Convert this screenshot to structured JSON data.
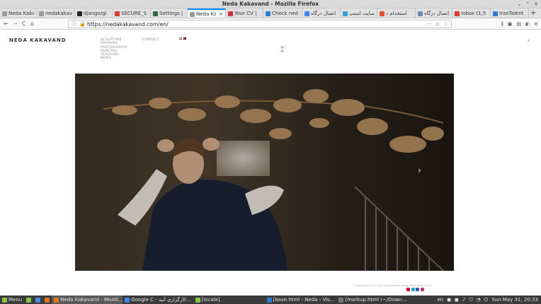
{
  "window": {
    "title": "Neda Kakavand - Mozilla Firefox",
    "controls": [
      "⌄",
      "⌃",
      "✕"
    ]
  },
  "tabs": [
    {
      "label": "Neda Kakava",
      "favicon_color": "#9a9a9a"
    },
    {
      "label": "nedakakavan",
      "favicon_color": "#9a9a9a"
    },
    {
      "label": "django/gi",
      "favicon_color": "#222222"
    },
    {
      "label": "SECURE_S",
      "favicon_color": "#d83b2c"
    },
    {
      "label": "Settings |",
      "favicon_color": "#2f6c3f"
    },
    {
      "label": "Neda Kaka",
      "favicon_color": "#9a9a9a",
      "active": true
    },
    {
      "label": "Your CV |",
      "favicon_color": "#cc3344"
    },
    {
      "label": "Check ned",
      "favicon_color": "#2d7cd6"
    },
    {
      "label": "اتصال درگاه",
      "favicon_color": "#4285f4"
    },
    {
      "label": "سایت اسنپ",
      "favicon_color": "#3aa0d6"
    },
    {
      "label": "استخدام د",
      "favicon_color": "#e0522a"
    },
    {
      "label": "اتصال درگاه",
      "favicon_color": "#6b8db8"
    },
    {
      "label": "Inbox (1,5",
      "favicon_color": "#d83b2c"
    },
    {
      "label": "IranTalent",
      "favicon_color": "#2d7cd6"
    }
  ],
  "new_tab_label": "+",
  "nav": {
    "back": "←",
    "forward": "→",
    "reload": "C",
    "home": "⌂",
    "url": "https://nedakakavand.com/en/",
    "info_icon": "ⓘ",
    "lock_icon": "🔒",
    "url_actions": [
      "···",
      "◇",
      "☆"
    ],
    "toolbar_icons": [
      "⫼",
      "▣",
      "▤",
      "◐",
      "≡"
    ]
  },
  "page": {
    "brand": "NEDA KAKAVAND",
    "menu": [
      "SCULPTURE",
      "DRAWING",
      "PHOTOGRAPHY",
      "PAINTING",
      "TEACHING",
      "NEWS"
    ],
    "contact": "CONTACT",
    "next_arrow": "›",
    "copyright": "© Neda Kakavand. All rights reserved 2023. Persian Studio Design Group",
    "search_icon": "⌕",
    "colors": {
      "flag_iran": [
        "#239f40",
        "#ffffff",
        "#da0000"
      ],
      "flag_uk": "#c8102e",
      "social": [
        "#e60023",
        "#1da1f2",
        "#3b5998",
        "#c13584"
      ]
    }
  },
  "taskbar": {
    "items": [
      {
        "label": "Menu",
        "icon_color": "#8fc34a"
      },
      {
        "label": "",
        "icon_color": "#8fc34a"
      },
      {
        "label": "",
        "icon_color": "#4a90d9"
      },
      {
        "label": "",
        "icon_color": "#e0781a"
      },
      {
        "label": "Neda Kakavand - Mozill...",
        "icon_color": "#e0781a",
        "active": true
      },
      {
        "label": "Google C - کارگزاری آنیه...",
        "icon_color": "#4285f4"
      },
      {
        "label": "[locale]",
        "icon_color": "#8fc34a"
      },
      {
        "label": "[base.html - Neda - Vis...",
        "icon_color": "#2d7cd6"
      },
      {
        "label": "[markup.html (~/Down...",
        "icon_color": "#777777"
      }
    ],
    "tray": {
      "lang": "en",
      "icons": [
        "◼",
        "◼",
        "♪",
        "⛉",
        "◔",
        "⏻"
      ],
      "clock": "Sun May 31, 20:33"
    }
  }
}
